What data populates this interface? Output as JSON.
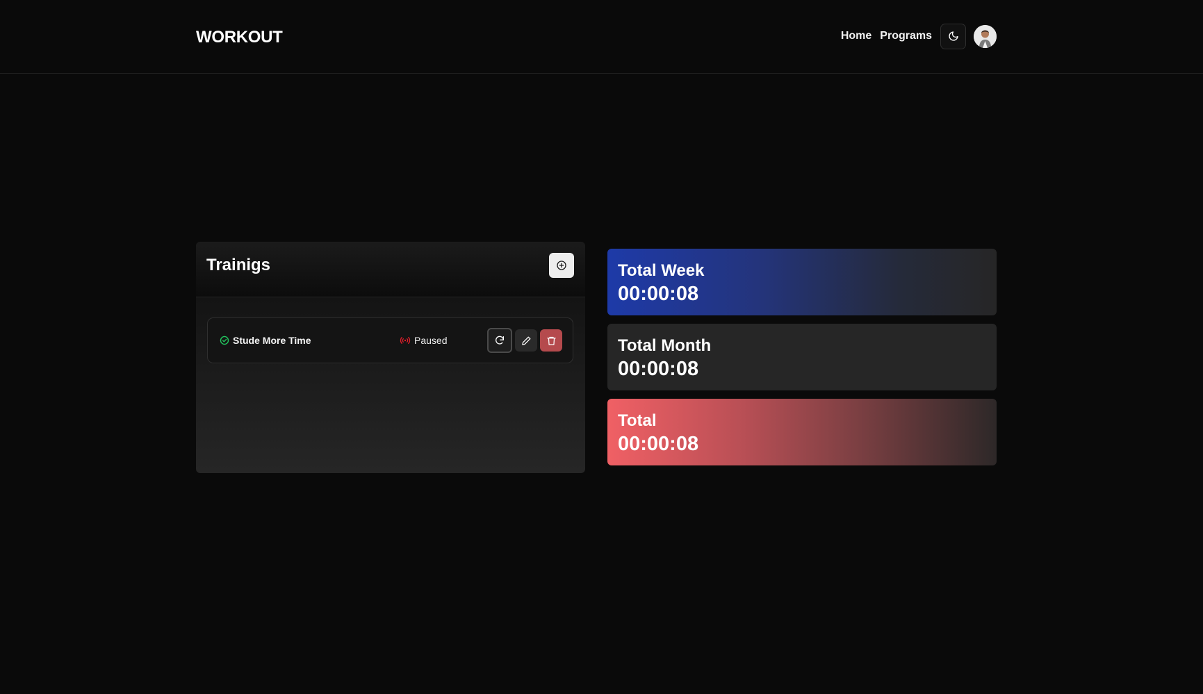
{
  "header": {
    "brand": "WORKOUT",
    "nav": [
      {
        "label": "Home"
      },
      {
        "label": "Programs"
      }
    ],
    "theme_icon": "moon-icon",
    "avatar_icon": "user-avatar"
  },
  "trainings": {
    "title": "Trainigs",
    "add_icon": "plus-circle-icon",
    "items": [
      {
        "name": "Stude More Time",
        "status": "Paused",
        "name_icon": "check-circle-icon",
        "status_icon": "broadcast-icon"
      }
    ]
  },
  "stats": {
    "week": {
      "label": "Total Week",
      "value": "00:00:08"
    },
    "month": {
      "label": "Total Month",
      "value": "00:00:08"
    },
    "total": {
      "label": "Total",
      "value": "00:00:08"
    }
  },
  "colors": {
    "background": "#0a0a0a",
    "success": "#22c55e",
    "paused": "#e11d2a",
    "delete": "#b54a4d",
    "week_accent": "#1e3aa8",
    "total_accent": "#f06065"
  }
}
